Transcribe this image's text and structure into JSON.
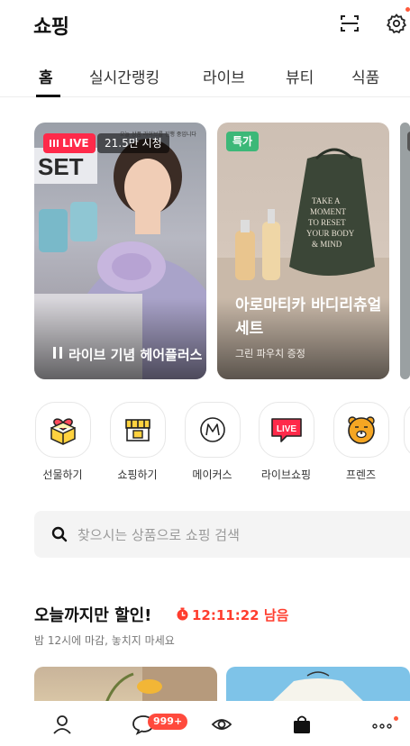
{
  "header": {
    "title": "쇼핑"
  },
  "tabs": [
    {
      "label": "홈",
      "active": true
    },
    {
      "label": "실시간랭킹",
      "active": false
    },
    {
      "label": "라이브",
      "active": false
    },
    {
      "label": "뷰티",
      "active": false
    },
    {
      "label": "식품",
      "active": false
    }
  ],
  "cards": [
    {
      "badge": "LIVE",
      "viewers": "21.5만 시청",
      "notice": "오늘 상품 라이브를 진행 중입니다",
      "title": "라이브 기념 헤어플러스"
    },
    {
      "badge": "특가",
      "title": "아로마티카 바디리츄얼 세트",
      "subtitle": "그린 파우치 증정"
    }
  ],
  "categories": [
    {
      "label": "선물하기",
      "icon": "gift-box-icon"
    },
    {
      "label": "쇼핑하기",
      "icon": "store-icon"
    },
    {
      "label": "메이커스",
      "icon": "makers-m-icon"
    },
    {
      "label": "라이브쇼핑",
      "icon": "live-shopping-icon"
    },
    {
      "label": "프렌즈",
      "icon": "friends-character-icon"
    }
  ],
  "search": {
    "placeholder": "찾으시는 상품으로 쇼핑 검색"
  },
  "sale": {
    "title": "오늘까지만 할인!",
    "timer": "12:11:22 남음",
    "subtitle": "밤 12시에 마감, 놓치지 마세요"
  },
  "bottom_nav": {
    "chat_badge": "999+"
  },
  "colors": {
    "live_red": "#ff2a4a",
    "deal_green": "#3cb878",
    "timer_red": "#ff3d2e",
    "badge_red": "#ff4a3d"
  }
}
